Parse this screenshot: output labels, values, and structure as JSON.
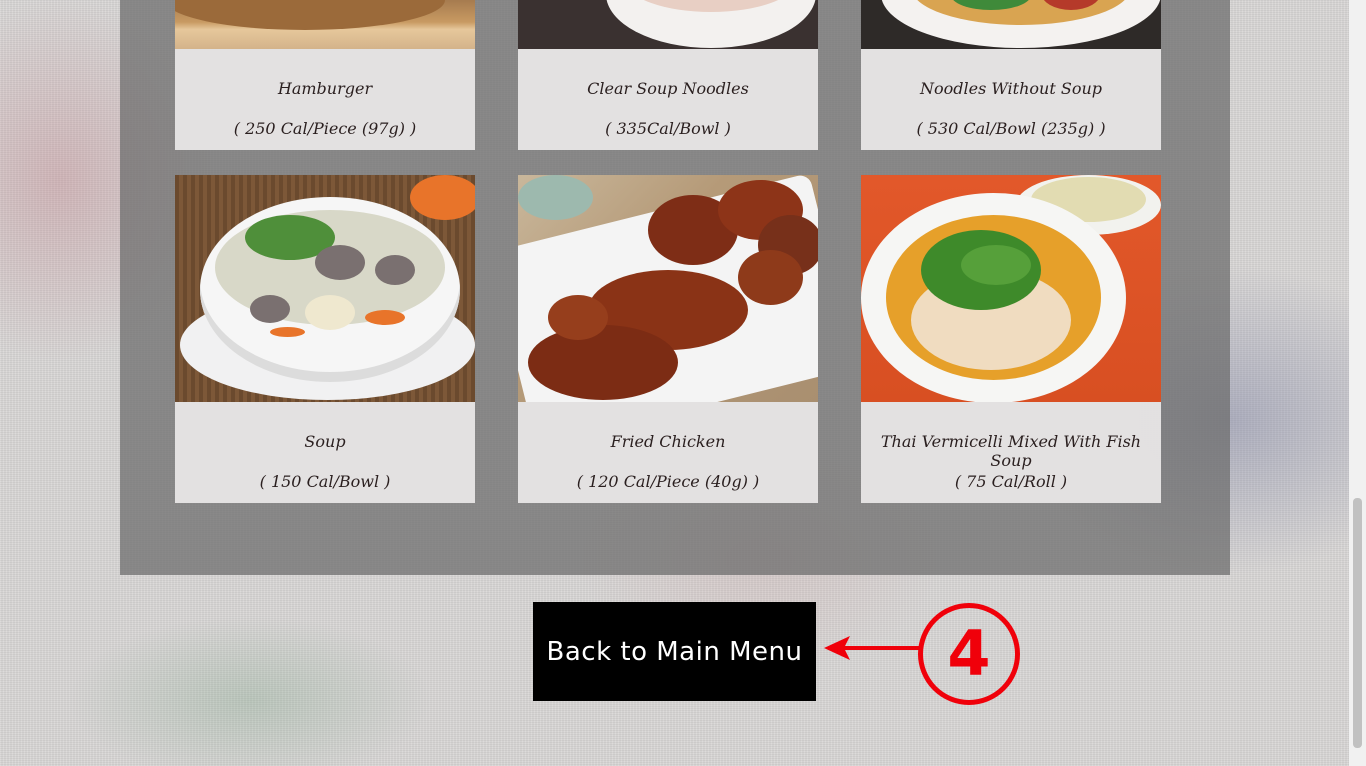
{
  "menu": {
    "items": [
      {
        "name": "Hamburger",
        "calories": "( 250 Cal/Piece (97g) )",
        "image": "hamburger-photo"
      },
      {
        "name": "Clear Soup Noodles",
        "calories": "( 335Cal/Bowl )",
        "image": "clear-soup-noodles-photo"
      },
      {
        "name": "Noodles Without Soup",
        "calories": "( 530 Cal/Bowl (235g) )",
        "image": "noodles-without-soup-photo"
      },
      {
        "name": "Soup",
        "calories": "( 150 Cal/Bowl )",
        "image": "soup-photo"
      },
      {
        "name": "Fried Chicken",
        "calories": "( 120 Cal/Piece (40g) )",
        "image": "fried-chicken-photo"
      },
      {
        "name": "Thai Vermicelli Mixed With Fish Soup",
        "calories": "( 75 Cal/Roll )",
        "image": "thai-vermicelli-photo"
      }
    ]
  },
  "actions": {
    "back_label": "Back to Main Menu"
  },
  "annotation": {
    "step_number": "4",
    "color": "#f0000a"
  }
}
